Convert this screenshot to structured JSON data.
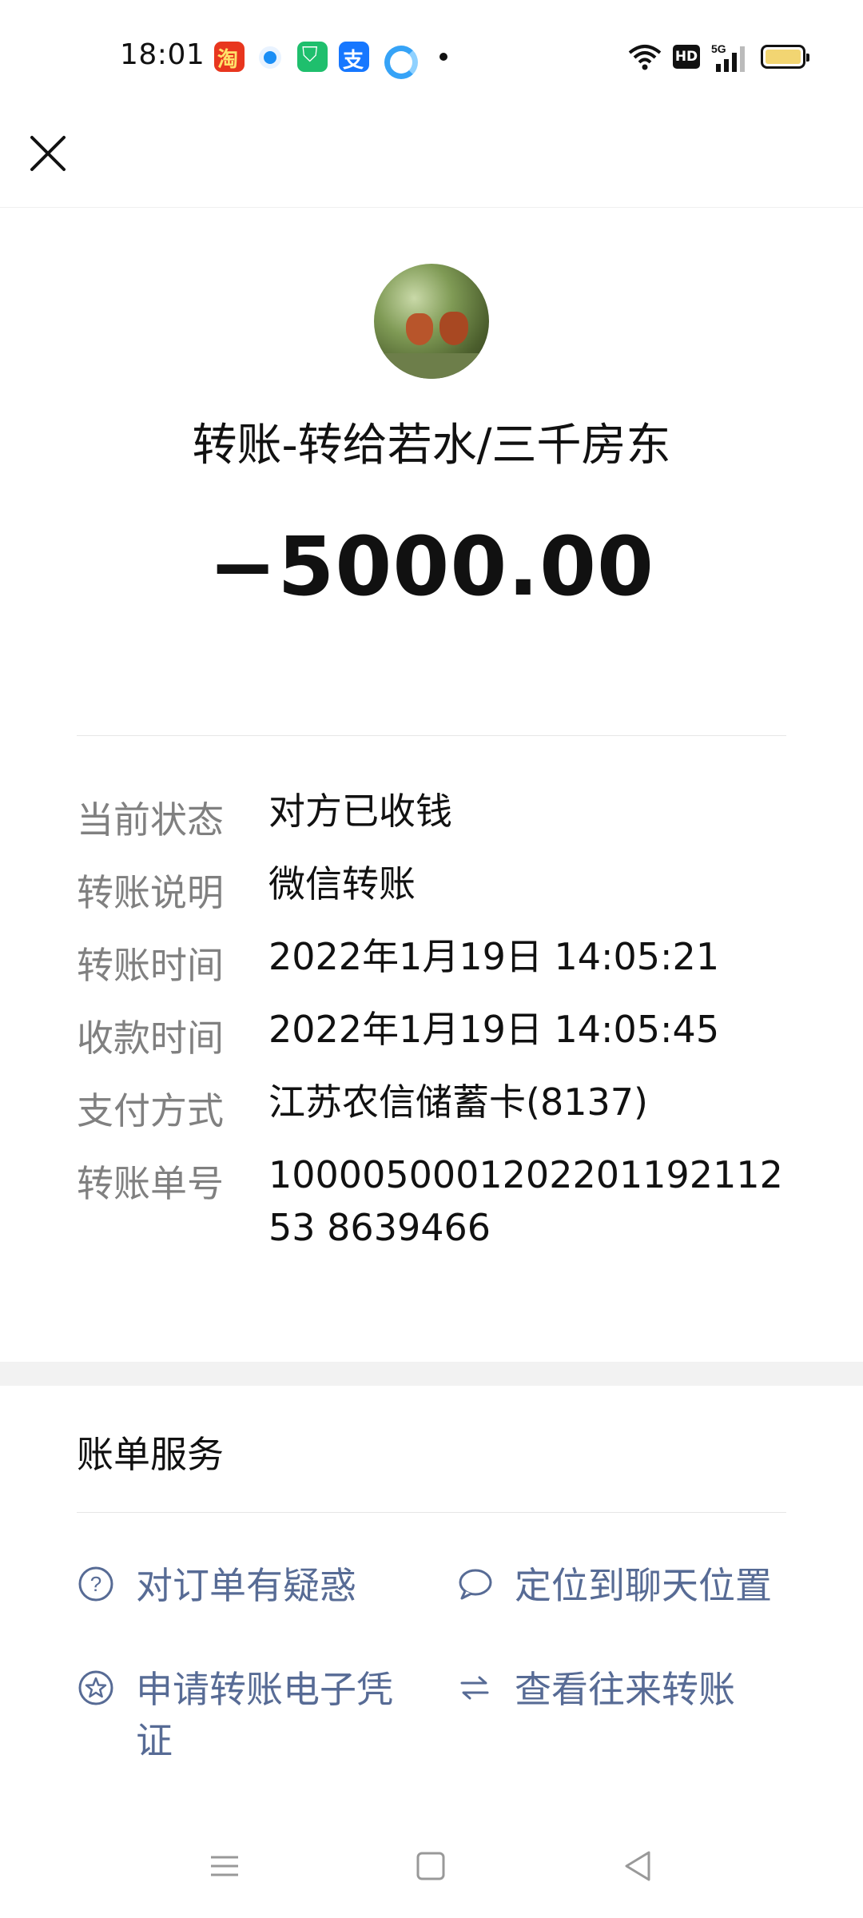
{
  "status_bar": {
    "time": "18:01",
    "apps": [
      "taobao-icon",
      "blue-circle-icon",
      "green-app-icon",
      "alipay-icon",
      "cloud-icon"
    ],
    "network": "5G",
    "hd": "HD"
  },
  "header": {
    "title": "转账-转给若水/三千房东",
    "amount": "−5000.00"
  },
  "details": [
    {
      "label": "当前状态",
      "value": "对方已收钱"
    },
    {
      "label": "转账说明",
      "value": "微信转账"
    },
    {
      "label": "转账时间",
      "value": "2022年1月19日 14:05:21"
    },
    {
      "label": "收款时间",
      "value": "2022年1月19日 14:05:45"
    },
    {
      "label": "支付方式",
      "value": "江苏农信储蓄卡(8137)"
    },
    {
      "label": "转账单号",
      "value": "100005000120220119211253 8639466"
    }
  ],
  "bill_service": {
    "title": "账单服务",
    "actions": [
      {
        "label": "对订单有疑惑",
        "icon": "question-circle-icon"
      },
      {
        "label": "定位到聊天位置",
        "icon": "chat-bubble-icon"
      },
      {
        "label": "申请转账电子凭证",
        "icon": "star-circle-icon"
      },
      {
        "label": "查看往来转账",
        "icon": "swap-arrows-icon"
      }
    ]
  },
  "colors": {
    "link": "#576b95",
    "label": "#808080",
    "text": "#111111",
    "section_gap": "#f2f2f2"
  }
}
